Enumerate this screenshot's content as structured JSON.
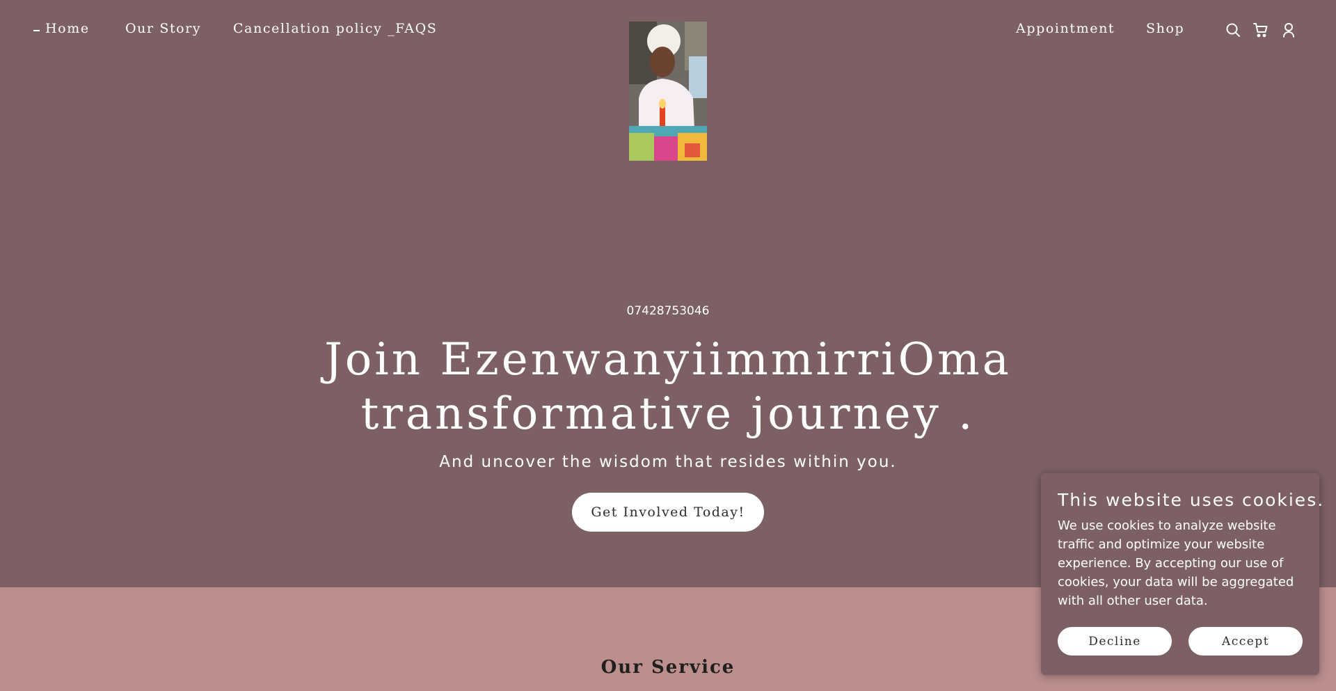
{
  "nav": {
    "left_items": [
      "Home",
      "Our Story",
      "Cancellation policy _FAQS"
    ],
    "right_items": [
      "Appointment",
      "Shop"
    ],
    "icons": [
      "search-icon",
      "cart-icon",
      "user-icon"
    ]
  },
  "hero": {
    "phone": "07428753046",
    "headline_line1": "Join EzenwanyiimmirriOma",
    "headline_line2": "transformative journey .",
    "subheadline": "And uncover the wisdom that resides within you.",
    "cta_label": "Get Involved Today!"
  },
  "services": {
    "title": "Our Service"
  },
  "cookie_banner": {
    "title": "This website uses cookies.",
    "body": "We use cookies to analyze website traffic and optimize your website experience. By accepting our use of cookies, your data will be aggregated with all other user data.",
    "decline_label": "Decline",
    "accept_label": "Accept"
  },
  "colors": {
    "hero_bg": "#7d6064",
    "services_bg": "#bc8e8e",
    "button_bg": "#ffffff",
    "text": "#ffffff"
  }
}
